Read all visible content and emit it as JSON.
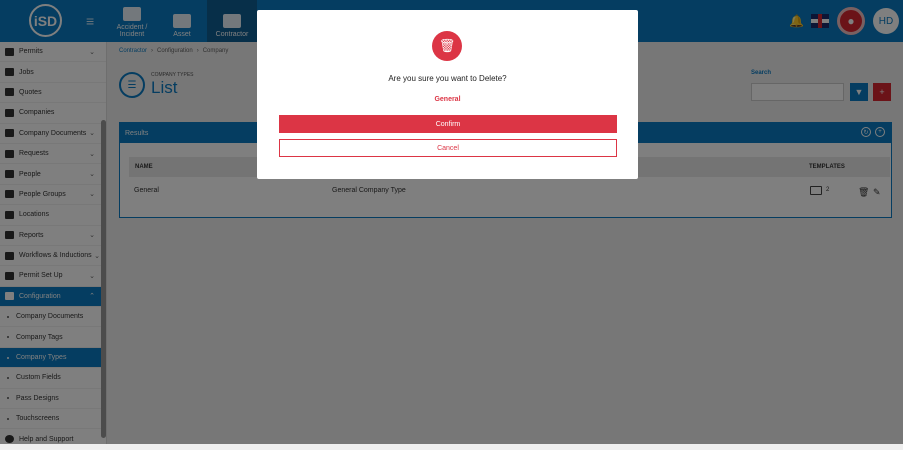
{
  "app": {
    "logo_text": "iSD"
  },
  "topnav": {
    "tabs": [
      {
        "label": "Accident / Incident"
      },
      {
        "label": "Asset"
      },
      {
        "label": "Contractor"
      }
    ],
    "user_initials": "HD"
  },
  "sidebar": {
    "items": [
      {
        "label": "Permits"
      },
      {
        "label": "Jobs"
      },
      {
        "label": "Quotes"
      },
      {
        "label": "Companies"
      },
      {
        "label": "Company Documents"
      },
      {
        "label": "Requests"
      },
      {
        "label": "People"
      },
      {
        "label": "People Groups"
      },
      {
        "label": "Locations"
      },
      {
        "label": "Reports"
      },
      {
        "label": "Workflows & Inductions"
      },
      {
        "label": "Permit Set Up"
      },
      {
        "label": "Configuration"
      },
      {
        "label": "Company Documents"
      },
      {
        "label": "Company Tags"
      },
      {
        "label": "Company Types"
      },
      {
        "label": "Custom Fields"
      },
      {
        "label": "Pass Designs"
      },
      {
        "label": "Touchscreens"
      },
      {
        "label": "Help and Support"
      }
    ]
  },
  "breadcrumb": {
    "item1": "Contractor",
    "item2": "Configuration",
    "item3": "Company"
  },
  "page": {
    "subtitle": "COMPANY TYPES",
    "title": "List"
  },
  "search": {
    "label": "Search",
    "placeholder": ""
  },
  "results": {
    "title": "Results",
    "columns": {
      "name": "NAME",
      "templates": "TEMPLATES"
    },
    "rows": [
      {
        "name": "General",
        "description": "General Company Type",
        "templates": "2"
      }
    ]
  },
  "modal": {
    "question": "Are you sure you want to Delete?",
    "item_name": "General",
    "confirm_label": "Confirm",
    "cancel_label": "Cancel"
  },
  "colors": {
    "brand": "#0a7bc2",
    "danger": "#dc3545"
  }
}
